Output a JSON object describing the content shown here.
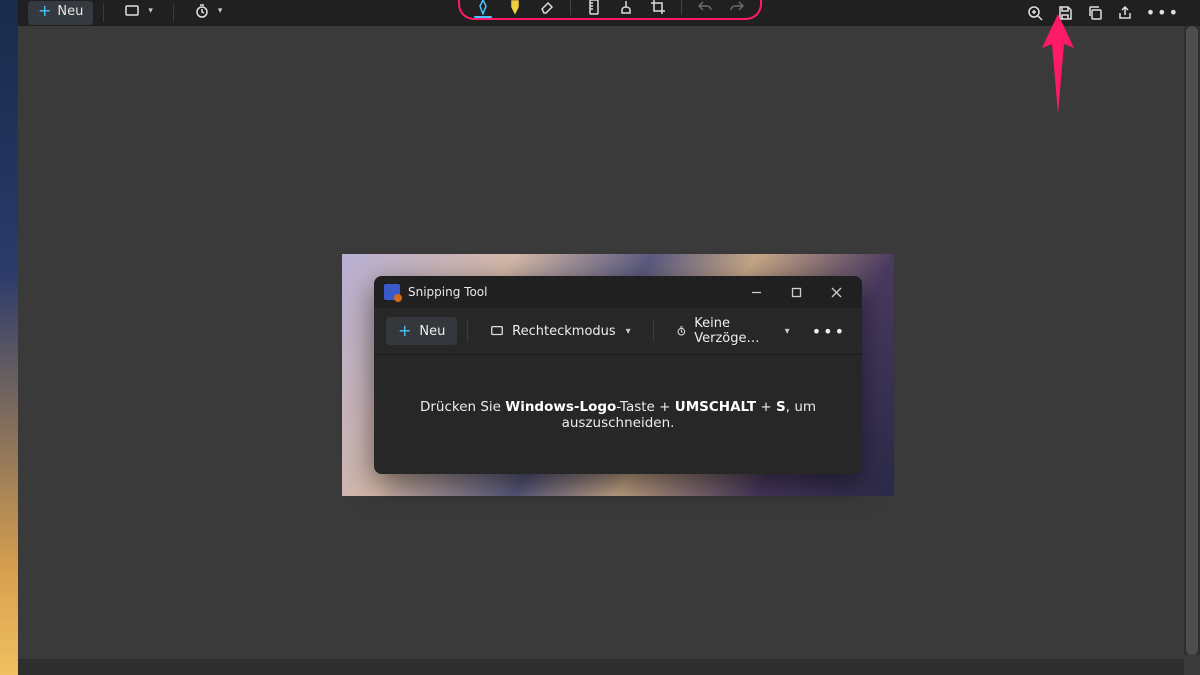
{
  "outer_toolbar": {
    "new_label": "Neu",
    "mode_dropdown_icon": "rectangle-mode-icon",
    "delay_dropdown_icon": "timer-icon"
  },
  "annotation_tools": {
    "pen_icon": "pen-icon",
    "highlighter_icon": "highlighter-icon",
    "eraser_icon": "eraser-icon",
    "ruler_icon": "ruler-icon",
    "touch_icon": "touch-writing-icon",
    "crop_icon": "crop-icon",
    "undo_icon": "undo-icon",
    "redo_icon": "redo-icon"
  },
  "right_tools": {
    "zoom_icon": "zoom-icon",
    "save_icon": "save-icon",
    "copy_icon": "copy-icon",
    "share_icon": "share-icon",
    "more_icon": "more-icon"
  },
  "annotation": {
    "highlight_color": "#ff1a66",
    "arrow_color": "#ff1a66",
    "arrow_target": "save-button"
  },
  "inner_window": {
    "title": "Snipping Tool",
    "new_label": "Neu",
    "mode_label": "Rechteckmodus",
    "delay_label": "Keine Verzöge…",
    "hint_prefix": "Drücken Sie ",
    "hint_key1": "Windows-Logo",
    "hint_mid1": "-Taste + ",
    "hint_key2": "UMSCHALT",
    "hint_mid2": " + ",
    "hint_key3": "S",
    "hint_suffix": ", um auszuschneiden."
  }
}
